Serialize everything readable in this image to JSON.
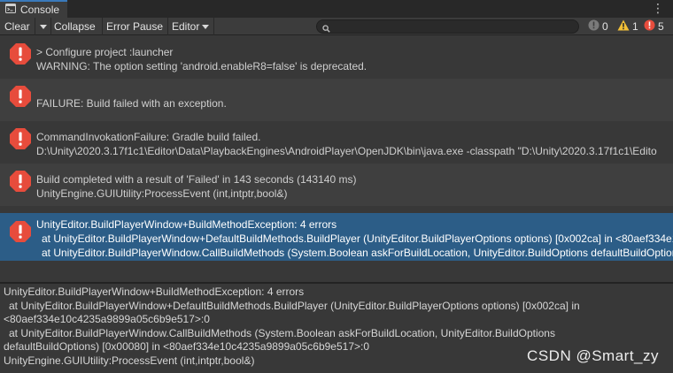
{
  "window": {
    "tab_title": "Console"
  },
  "toolbar": {
    "clear_label": "Clear",
    "collapse_label": "Collapse",
    "error_pause_label": "Error Pause",
    "editor_label": "Editor",
    "search_placeholder": ""
  },
  "counters": {
    "info": "0",
    "warnings": "1",
    "errors": "5"
  },
  "colors": {
    "accent": "#3a79bb",
    "selection": "#2c5d87",
    "error": "#e74c3c",
    "warning": "#f2c037"
  },
  "entries": [
    {
      "icon": "error-icon",
      "lines": [
        "> Configure project :launcher",
        "WARNING: The option setting 'android.enableR8=false' is deprecated."
      ]
    },
    {
      "icon": "error-icon",
      "lines": [
        "FAILURE: Build failed with an exception."
      ]
    },
    {
      "icon": "error-icon",
      "lines": [
        "CommandInvokationFailure: Gradle build failed.",
        "D:\\Unity\\2020.3.17f1c1\\Editor\\Data\\PlaybackEngines\\AndroidPlayer\\OpenJDK\\bin\\java.exe -classpath \"D:\\Unity\\2020.3.17f1c1\\Edito"
      ]
    },
    {
      "icon": "error-icon",
      "lines": [
        "Build completed with a result of 'Failed' in 143 seconds (143140 ms)",
        "UnityEngine.GUIUtility:ProcessEvent (int,intptr,bool&)"
      ]
    },
    {
      "icon": "error-icon",
      "lines": [
        "UnityEditor.BuildPlayerWindow+BuildMethodException: 4 errors",
        "at UnityEditor.BuildPlayerWindow+DefaultBuildMethods.BuildPlayer (UnityEditor.BuildPlayerOptions options) [0x002ca] in <80aef334e10c4235a9899a05c6b9e517>:0",
        "at UnityEditor.BuildPlayerWindow.CallBuildMethods (System.Boolean askForBuildLocation, UnityEditor.BuildOptions defaultBuildOptions) [0x00080] in <80aef334e10c4235a9899a05c6b9e517>:0"
      ]
    }
  ],
  "detail": {
    "lines": [
      "UnityEditor.BuildPlayerWindow+BuildMethodException: 4 errors",
      "at UnityEditor.BuildPlayerWindow+DefaultBuildMethods.BuildPlayer (UnityEditor.BuildPlayerOptions options) [0x002ca] in",
      "<80aef334e10c4235a9899a05c6b9e517>:0",
      "at UnityEditor.BuildPlayerWindow.CallBuildMethods (System.Boolean askForBuildLocation, UnityEditor.BuildOptions",
      "defaultBuildOptions) [0x00080] in <80aef334e10c4235a9899a05c6b9e517>:0",
      "UnityEngine.GUIUtility:ProcessEvent (int,intptr,bool&)"
    ]
  },
  "watermark": "CSDN @Smart_zy"
}
